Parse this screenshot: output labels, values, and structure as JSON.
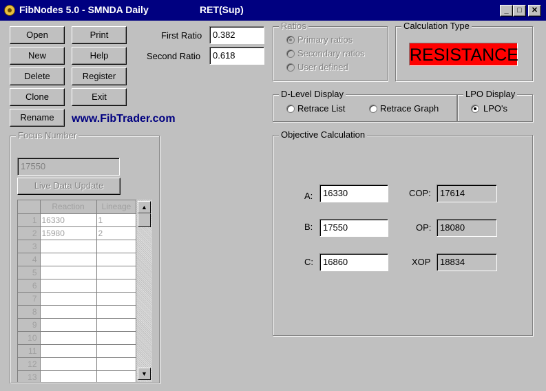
{
  "window": {
    "title": "FibNodes 5.0 - SMNDA Daily",
    "mode": "RET(Sup)",
    "min_label": "_",
    "max_label": "□",
    "close_label": "✕"
  },
  "buttons": {
    "open": "Open",
    "print": "Print",
    "new": "New",
    "help": "Help",
    "delete": "Delete",
    "register": "Register",
    "clone": "Clone",
    "exit": "Exit",
    "rename": "Rename"
  },
  "ratios": {
    "first_label": "First Ratio",
    "first_value": "0.382",
    "second_label": "Second Ratio",
    "second_value": "0.618"
  },
  "ratios_group": {
    "title": "Ratios",
    "options": [
      "Primary ratios",
      "Secondary ratios",
      "User defined"
    ],
    "selected": "Primary ratios"
  },
  "calc_type": {
    "title": "Calculation Type",
    "value": "RESISTANCE",
    "color": "#ff0000"
  },
  "link_text": "www.FibTrader.com",
  "dlevel": {
    "title": "D-Level Display",
    "options": [
      "Retrace List",
      "Retrace Graph"
    ],
    "selected": null
  },
  "lpo": {
    "title": "LPO Display",
    "option": "LPO's",
    "selected": "LPO's"
  },
  "focus": {
    "title": "Focus Number",
    "value": "17550",
    "live_button": "Live Data Update",
    "columns": [
      "",
      "Reaction",
      "Lineage"
    ],
    "rows": [
      [
        "1",
        "16330",
        "1"
      ],
      [
        "2",
        "15980",
        "2"
      ],
      [
        "3",
        "",
        ""
      ],
      [
        "4",
        "",
        ""
      ],
      [
        "5",
        "",
        ""
      ],
      [
        "6",
        "",
        ""
      ],
      [
        "7",
        "",
        ""
      ],
      [
        "8",
        "",
        ""
      ],
      [
        "9",
        "",
        ""
      ],
      [
        "10",
        "",
        ""
      ],
      [
        "11",
        "",
        ""
      ],
      [
        "12",
        "",
        ""
      ],
      [
        "13",
        "",
        ""
      ]
    ]
  },
  "objective": {
    "title": "Objective Calculation",
    "a_label": "A:",
    "a_value": "16330",
    "b_label": "B:",
    "b_value": "17550",
    "c_label": "C:",
    "c_value": "16860",
    "cop_label": "COP:",
    "cop_value": "17614",
    "op_label": "OP:",
    "op_value": "18080",
    "xop_label": "XOP",
    "xop_value": "18834"
  }
}
